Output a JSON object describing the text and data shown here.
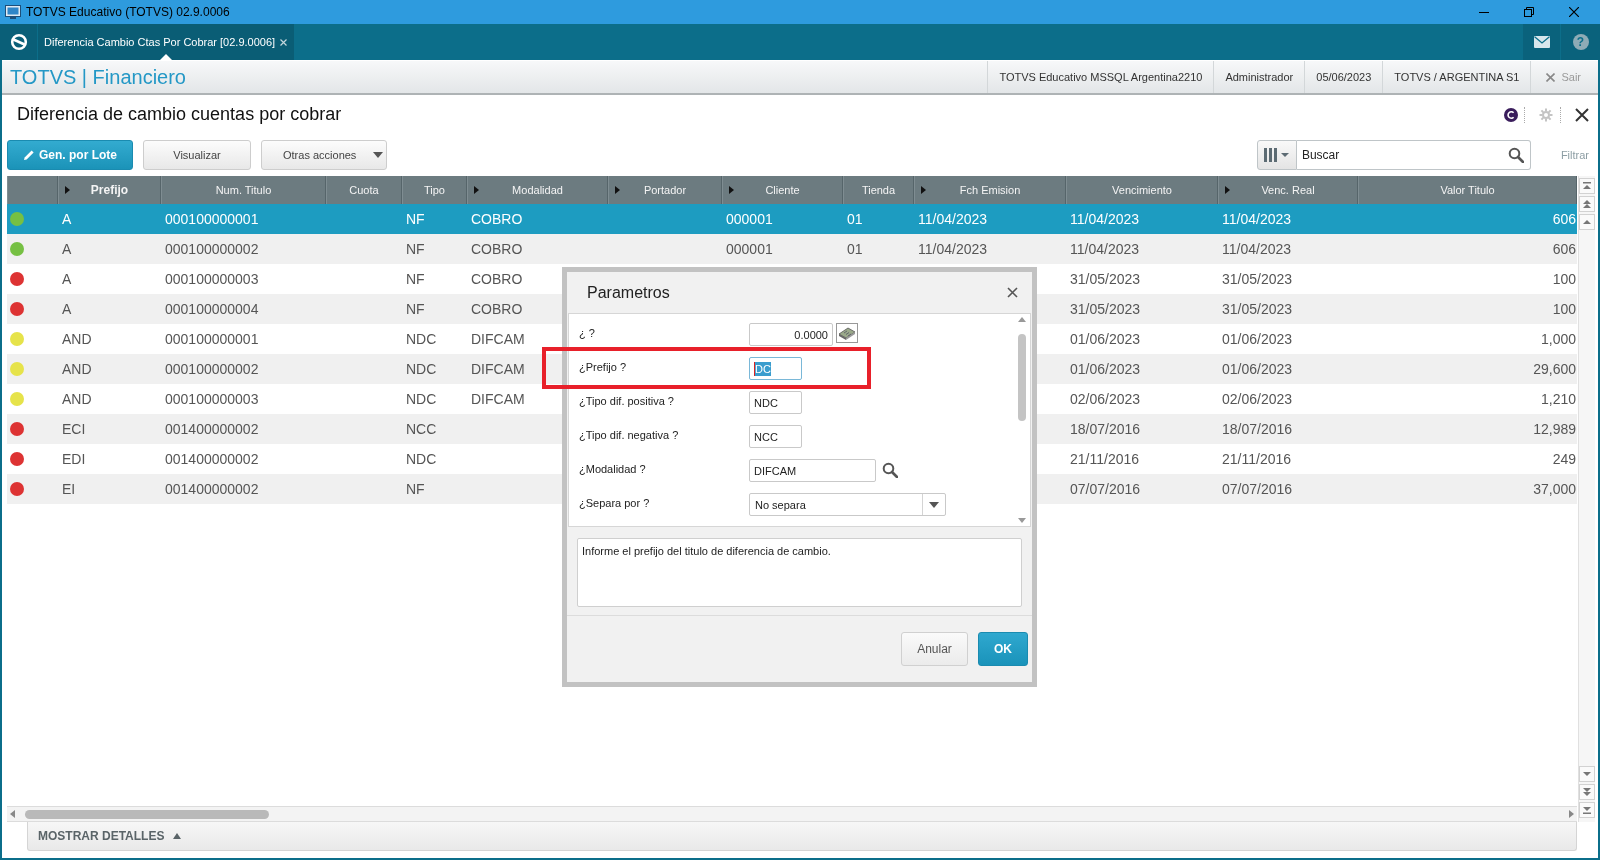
{
  "window": {
    "title": "TOTVS Educativo (TOTVS) 02.9.0006"
  },
  "top_bar": {
    "tabs": [
      {
        "label": "Diferencia Cambio Ctas Por Cobrar [02.9.0006]",
        "selected": true
      }
    ],
    "help": "?"
  },
  "header": {
    "title": "TOTVS | Financiero",
    "info": [
      "TOTVS Educativo MSSQL Argentina2210",
      "Administrador",
      "05/06/2023",
      "TOTVS / ARGENTINA S1"
    ],
    "logout": "Sair"
  },
  "page": {
    "title": "Diferencia de cambio cuentas por cobrar"
  },
  "toolbar": {
    "buttons": [
      {
        "label": "Gen. por Lote",
        "kind": "primary"
      },
      {
        "label": "Visualizar",
        "kind": "default"
      },
      {
        "label": "Otras acciones",
        "kind": "menu"
      }
    ],
    "search": {
      "placeholder": "Buscar"
    },
    "filter": "Filtrar"
  },
  "table": {
    "columns": [
      {
        "label": "Prefijo",
        "kind": "text",
        "indexed": true,
        "active": true
      },
      {
        "label": "Num. Titulo",
        "kind": "text",
        "indexed": false,
        "active": false
      },
      {
        "label": "Cuota",
        "kind": "text",
        "indexed": false,
        "active": false
      },
      {
        "label": "Tipo",
        "kind": "text",
        "indexed": false,
        "active": false
      },
      {
        "label": "Modalidad",
        "kind": "text",
        "indexed": true,
        "active": false
      },
      {
        "label": "Portador",
        "kind": "text",
        "indexed": true,
        "active": false
      },
      {
        "label": "Cliente",
        "kind": "text",
        "indexed": true,
        "active": false
      },
      {
        "label": "Tienda",
        "kind": "text",
        "indexed": false,
        "active": false
      },
      {
        "label": "Fch Emision",
        "kind": "text",
        "indexed": true,
        "active": false
      },
      {
        "label": "Vencimiento",
        "kind": "text",
        "indexed": false,
        "active": false
      },
      {
        "label": "Venc. Real",
        "kind": "text",
        "indexed": true,
        "active": false
      },
      {
        "label": "Valor Titulo",
        "kind": "amount",
        "indexed": false,
        "active": false
      }
    ],
    "rows": [
      {
        "color": "#76c043",
        "selected": true,
        "cells": [
          "A",
          "000100000001",
          null,
          "NF",
          "COBRO",
          null,
          "000001",
          "01",
          "11/04/2023",
          "11/04/2023",
          "11/04/2023",
          "606"
        ]
      },
      {
        "color": "#76c043",
        "selected": false,
        "cells": [
          "A",
          "000100000002",
          null,
          "NF",
          "COBRO",
          null,
          "000001",
          "01",
          "11/04/2023",
          "11/04/2023",
          "11/04/2023",
          "606"
        ]
      },
      {
        "color": "#dd3333",
        "selected": false,
        "cells": [
          "A",
          "000100000003",
          null,
          "NF",
          "COBRO",
          null,
          null,
          null,
          null,
          "31/05/2023",
          "31/05/2023",
          "100"
        ]
      },
      {
        "color": "#dd3333",
        "selected": false,
        "cells": [
          "A",
          "000100000004",
          null,
          "NF",
          "COBRO",
          null,
          null,
          null,
          null,
          "31/05/2023",
          "31/05/2023",
          "100"
        ]
      },
      {
        "color": "#e6e34a",
        "selected": false,
        "cells": [
          "AND",
          "000100000001",
          null,
          "NDC",
          "DIFCAM",
          null,
          null,
          null,
          null,
          "01/06/2023",
          "01/06/2023",
          "1,000"
        ]
      },
      {
        "color": "#e6e34a",
        "selected": false,
        "cells": [
          "AND",
          "000100000002",
          null,
          "NDC",
          "DIFCAM",
          null,
          null,
          null,
          null,
          "01/06/2023",
          "01/06/2023",
          "29,600"
        ]
      },
      {
        "color": "#e6e34a",
        "selected": false,
        "cells": [
          "AND",
          "000100000003",
          null,
          "NDC",
          "DIFCAM",
          null,
          null,
          null,
          null,
          "02/06/2023",
          "02/06/2023",
          "1,210"
        ]
      },
      {
        "color": "#dd3333",
        "selected": false,
        "cells": [
          "ECI",
          "001400000002",
          null,
          "NCC",
          null,
          null,
          null,
          null,
          null,
          "18/07/2016",
          "18/07/2016",
          "12,989"
        ]
      },
      {
        "color": "#dd3333",
        "selected": false,
        "cells": [
          "EDI",
          "001400000002",
          null,
          "NDC",
          null,
          null,
          null,
          null,
          null,
          "21/11/2016",
          "21/11/2016",
          "249"
        ]
      },
      {
        "color": "#dd3333",
        "selected": false,
        "cells": [
          "EI",
          "001400000002",
          null,
          "NF",
          null,
          null,
          null,
          null,
          null,
          "07/07/2016",
          "07/07/2016",
          "37,000"
        ]
      }
    ]
  },
  "dialog": {
    "title": "Parametros",
    "params": [
      {
        "label": "¿ ?",
        "kind": "number",
        "value": "0.0000",
        "focused": false,
        "marked": false
      },
      {
        "label": "¿Prefijo ?",
        "kind": "text",
        "value": "DC",
        "focused": true,
        "marked": true
      },
      {
        "label": "¿Tipo dif. positiva ?",
        "kind": "text",
        "value": "NDC",
        "focused": false,
        "marked": false
      },
      {
        "label": "¿Tipo dif. negativa ?",
        "kind": "text",
        "value": "NCC",
        "focused": false,
        "marked": false
      },
      {
        "label": "¿Modalidad ?",
        "kind": "lookup",
        "value": "DIFCAM",
        "focused": false,
        "marked": false
      },
      {
        "label": "¿Separa por ?",
        "kind": "select",
        "value": "No separa",
        "focused": false,
        "marked": false
      }
    ],
    "help": "Informe el prefijo del titulo de diferencia de cambio.",
    "buttons": [
      {
        "label": "Anular",
        "kind": "default"
      },
      {
        "label": "OK",
        "kind": "primary"
      }
    ]
  },
  "details_toggle": "MOSTRAR DETALLES"
}
